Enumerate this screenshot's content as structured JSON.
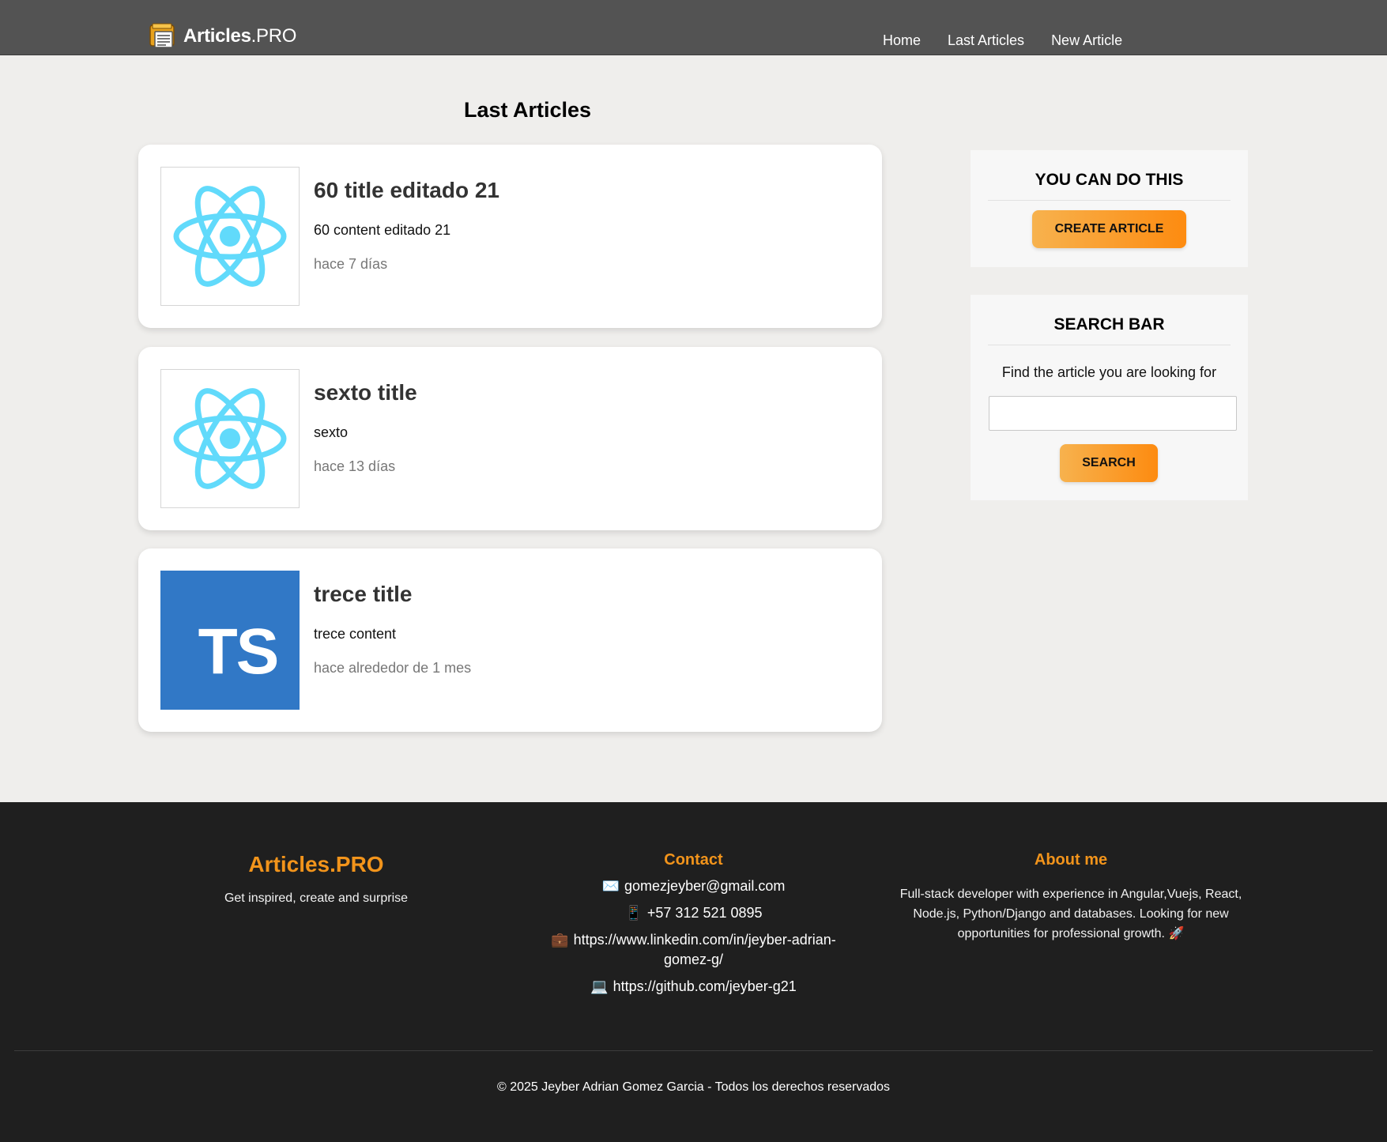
{
  "header": {
    "brand_bold": "Articles",
    "brand_rest": ".PRO",
    "nav": [
      {
        "label": "Home"
      },
      {
        "label": "Last Articles"
      },
      {
        "label": "New Article"
      }
    ]
  },
  "main": {
    "title": "Last Articles",
    "articles": [
      {
        "image": "react-icon",
        "title": "60 title editado 21",
        "content": "60 content editado 21",
        "date": "hace 7 días"
      },
      {
        "image": "react-icon",
        "title": "sexto title",
        "content": "sexto",
        "date": "hace 13 días"
      },
      {
        "image": "typescript-logo",
        "image_text": "TS",
        "title": "trece title",
        "content": "trece content",
        "date": "hace alrededor de 1 mes"
      }
    ]
  },
  "sidebar": {
    "cta": {
      "title": "YOU CAN DO THIS",
      "button": "CREATE ARTICLE"
    },
    "search": {
      "title": "SEARCH BAR",
      "text": "Find the article you are looking for",
      "input_value": "",
      "button": "SEARCH"
    }
  },
  "footer": {
    "brand": {
      "title": "Articles.PRO",
      "tagline": "Get inspired, create and surprise"
    },
    "contact": {
      "title": "Contact",
      "items": [
        {
          "icon": "envelope-icon",
          "glyph": "✉️",
          "text": "gomezjeyber@gmail.com"
        },
        {
          "icon": "phone-icon",
          "glyph": "📱",
          "text": "+57 312 521 0895"
        },
        {
          "icon": "briefcase-icon",
          "glyph": "💼",
          "text": "https://www.linkedin.com/in/jeyber-adrian-gomez-g/"
        },
        {
          "icon": "laptop-icon",
          "glyph": "💻",
          "text": "https://github.com/jeyber-g21"
        }
      ]
    },
    "about": {
      "title": "About me",
      "text": "Full-stack developer with experience in Angular,Vuejs, React, Node.js, Python/Django and databases. Looking for new opportunities for professional growth. 🚀"
    },
    "copyright": "© 2025 Jeyber Adrian Gomez Garcia - Todos los derechos reservados"
  },
  "colors": {
    "header_bg": "#535353",
    "page_bg": "#efeeec",
    "accent_orange": "#f2941b",
    "button_gradient_start": "#f7b24e",
    "button_gradient_end": "#fd8b10",
    "footer_bg": "#1f1f1f",
    "react_blue": "#61dafb",
    "typescript_blue": "#3178c6"
  }
}
